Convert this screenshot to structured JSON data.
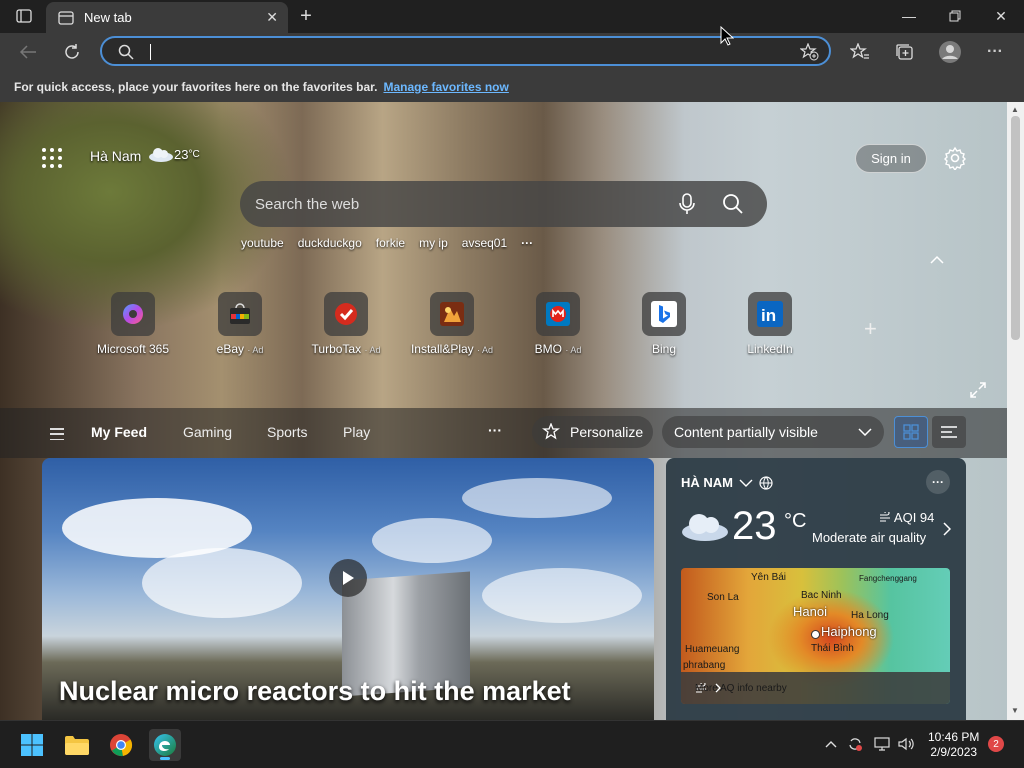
{
  "browser": {
    "tab_title": "New tab",
    "address_value": "",
    "favbar_text": "For quick access, place your favorites here on the favorites bar.",
    "favbar_link": "Manage favorites now"
  },
  "ntp": {
    "location": "Hà Nam",
    "temp_short": "23",
    "temp_unit": "°C",
    "signin_label": "Sign in",
    "search_placeholder": "Search the web",
    "suggestions": [
      "youtube",
      "duckduckgo",
      "forkie",
      "my ip",
      "avseq01"
    ],
    "suggestions_more": "···",
    "tiles": [
      {
        "name": "Microsoft 365",
        "ad": "",
        "icon": "microsoft-365-icon"
      },
      {
        "name": "eBay",
        "ad": "· Ad",
        "icon": "ebay-icon"
      },
      {
        "name": "TurboTax",
        "ad": "· Ad",
        "icon": "turbotax-icon"
      },
      {
        "name": "Install&Play",
        "ad": "· Ad",
        "icon": "install-play-icon"
      },
      {
        "name": "BMO",
        "ad": "· Ad",
        "icon": "bmo-icon"
      },
      {
        "name": "Bing",
        "ad": "",
        "icon": "bing-icon"
      },
      {
        "name": "LinkedIn",
        "ad": "",
        "icon": "linkedin-icon"
      }
    ],
    "add_tile": "+"
  },
  "feed": {
    "nav": [
      "My Feed",
      "Gaming",
      "Sports",
      "Play"
    ],
    "more": "···",
    "personalize": "Personalize",
    "content_dropdown": "Content partially visible",
    "headline": "Nuclear micro reactors to hit the market"
  },
  "weather": {
    "location": "HÀ NAM",
    "temp": "23",
    "unit": "°C",
    "aqi": "AQI 94",
    "aqi_text": "Moderate air quality",
    "map_labels": {
      "yen_bai": "Yên Bái",
      "fangcheng": "Fangchenggang",
      "son_la": "Son La",
      "bac_ninh": "Bac Ninh",
      "hanoi": "Hanoi",
      "ha_long": "Ha Long",
      "haiphong": "Haiphong",
      "huameuang": "Huameuang",
      "thai_binh": "Thái Bình",
      "phrabang": "phrabang"
    },
    "map_link": "More AQ info nearby"
  },
  "taskbar": {
    "time": "10:46 PM",
    "date": "2/9/2023",
    "notifications": "2"
  },
  "colors": {
    "accent": "#4c8fd6",
    "link": "#6cb8ff",
    "notif": "#e04848"
  }
}
